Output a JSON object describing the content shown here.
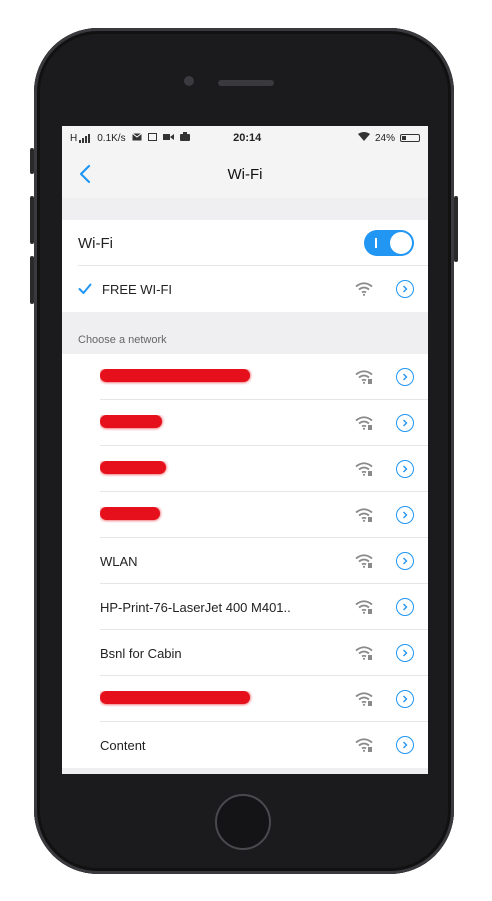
{
  "status_bar": {
    "left_icons": "H",
    "net_speed": "0.1K/s",
    "time": "20:14",
    "battery": "24%",
    "battery_level": 0.24
  },
  "nav": {
    "back_icon": "chevron-left-icon",
    "title": "Wi-Fi"
  },
  "wifi": {
    "label": "Wi-Fi",
    "enabled": true
  },
  "connected_network": {
    "name": "FREE WI-FI",
    "check_icon": "checkmark-icon"
  },
  "available": {
    "header": "Choose a network",
    "networks": [
      {
        "name": "",
        "redacted": true
      },
      {
        "name": "",
        "redacted": true
      },
      {
        "name": "",
        "redacted": true
      },
      {
        "name": "",
        "redacted": true
      },
      {
        "name": "WLAN",
        "redacted": false
      },
      {
        "name": "HP-Print-76-LaserJet 400 M401..",
        "redacted": false
      },
      {
        "name": "Bsnl for Cabin",
        "redacted": false
      },
      {
        "name": "",
        "redacted": true
      },
      {
        "name": "Content",
        "redacted": false
      }
    ]
  },
  "colors": {
    "accent": "#2196f3",
    "redaction": "#e5101b"
  }
}
